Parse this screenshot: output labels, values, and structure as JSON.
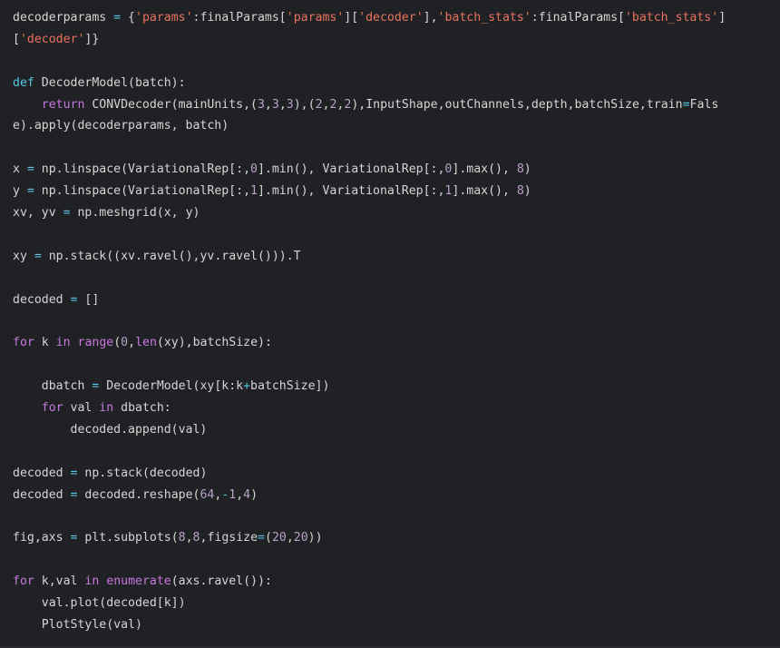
{
  "colors": {
    "background": "#202124",
    "text": "#d5d5d5",
    "keyword": "#c679dd",
    "def_keyword": "#58c7e0",
    "string": "#e8735e",
    "number": "#b9a0c8",
    "operator": "#58c7e0"
  },
  "code_lines": [
    [
      [
        "p",
        "decoderparams "
      ],
      [
        "o",
        "="
      ],
      [
        "p",
        " {"
      ],
      [
        "s",
        "'params'"
      ],
      [
        "p",
        ":finalParams["
      ],
      [
        "s",
        "'params'"
      ],
      [
        "p",
        "]["
      ],
      [
        "s",
        "'decoder'"
      ],
      [
        "p",
        "],"
      ],
      [
        "s",
        "'batch_stats'"
      ],
      [
        "p",
        ":finalParams["
      ],
      [
        "s",
        "'batch_stats'"
      ],
      [
        "p",
        "]"
      ]
    ],
    [
      [
        "p",
        "["
      ],
      [
        "s",
        "'decoder'"
      ],
      [
        "p",
        "]}"
      ]
    ],
    [],
    [
      [
        "d",
        "def"
      ],
      [
        "p",
        " DecoderModel(batch):"
      ]
    ],
    [
      [
        "p",
        "    "
      ],
      [
        "k",
        "return"
      ],
      [
        "p",
        " CONVDecoder(mainUnits,("
      ],
      [
        "n",
        "3"
      ],
      [
        "p",
        ","
      ],
      [
        "n",
        "3"
      ],
      [
        "p",
        ","
      ],
      [
        "n",
        "3"
      ],
      [
        "p",
        "),("
      ],
      [
        "n",
        "2"
      ],
      [
        "p",
        ","
      ],
      [
        "n",
        "2"
      ],
      [
        "p",
        ","
      ],
      [
        "n",
        "2"
      ],
      [
        "p",
        "),InputShape,outChannels,depth,batchSize,train"
      ],
      [
        "o",
        "="
      ],
      [
        "p",
        "Fals"
      ]
    ],
    [
      [
        "p",
        "e).apply(decoderparams, batch)"
      ]
    ],
    [],
    [
      [
        "p",
        "x "
      ],
      [
        "o",
        "="
      ],
      [
        "p",
        " np.linspace(VariationalRep[:,"
      ],
      [
        "n",
        "0"
      ],
      [
        "p",
        "].min(), VariationalRep[:,"
      ],
      [
        "n",
        "0"
      ],
      [
        "p",
        "].max(), "
      ],
      [
        "n",
        "8"
      ],
      [
        "p",
        ")"
      ]
    ],
    [
      [
        "p",
        "y "
      ],
      [
        "o",
        "="
      ],
      [
        "p",
        " np.linspace(VariationalRep[:,"
      ],
      [
        "n",
        "1"
      ],
      [
        "p",
        "].min(), VariationalRep[:,"
      ],
      [
        "n",
        "1"
      ],
      [
        "p",
        "].max(), "
      ],
      [
        "n",
        "8"
      ],
      [
        "p",
        ")"
      ]
    ],
    [
      [
        "p",
        "xv, yv "
      ],
      [
        "o",
        "="
      ],
      [
        "p",
        " np.meshgrid(x, y)"
      ]
    ],
    [],
    [
      [
        "p",
        "xy "
      ],
      [
        "o",
        "="
      ],
      [
        "p",
        " np.stack((xv.ravel(),yv.ravel())).T"
      ]
    ],
    [],
    [
      [
        "p",
        "decoded "
      ],
      [
        "o",
        "="
      ],
      [
        "p",
        " []"
      ]
    ],
    [],
    [
      [
        "k",
        "for"
      ],
      [
        "p",
        " k "
      ],
      [
        "k",
        "in"
      ],
      [
        "p",
        " "
      ],
      [
        "k",
        "range"
      ],
      [
        "p",
        "("
      ],
      [
        "n",
        "0"
      ],
      [
        "p",
        ","
      ],
      [
        "k",
        "len"
      ],
      [
        "p",
        "(xy),batchSize):"
      ]
    ],
    [],
    [
      [
        "p",
        "    dbatch "
      ],
      [
        "o",
        "="
      ],
      [
        "p",
        " DecoderModel(xy[k:k"
      ],
      [
        "o",
        "+"
      ],
      [
        "p",
        "batchSize])"
      ]
    ],
    [
      [
        "p",
        "    "
      ],
      [
        "k",
        "for"
      ],
      [
        "p",
        " val "
      ],
      [
        "k",
        "in"
      ],
      [
        "p",
        " dbatch:"
      ]
    ],
    [
      [
        "p",
        "        decoded.append(val)"
      ]
    ],
    [],
    [
      [
        "p",
        "decoded "
      ],
      [
        "o",
        "="
      ],
      [
        "p",
        " np.stack(decoded)"
      ]
    ],
    [
      [
        "p",
        "decoded "
      ],
      [
        "o",
        "="
      ],
      [
        "p",
        " decoded.reshape("
      ],
      [
        "n",
        "64"
      ],
      [
        "p",
        ","
      ],
      [
        "o",
        "-"
      ],
      [
        "n",
        "1"
      ],
      [
        "p",
        ","
      ],
      [
        "n",
        "4"
      ],
      [
        "p",
        ")"
      ]
    ],
    [],
    [
      [
        "p",
        "fig,axs "
      ],
      [
        "o",
        "="
      ],
      [
        "p",
        " plt.subplots("
      ],
      [
        "n",
        "8"
      ],
      [
        "p",
        ","
      ],
      [
        "n",
        "8"
      ],
      [
        "p",
        ",figsize"
      ],
      [
        "o",
        "="
      ],
      [
        "p",
        "("
      ],
      [
        "n",
        "20"
      ],
      [
        "p",
        ","
      ],
      [
        "n",
        "20"
      ],
      [
        "p",
        "))"
      ]
    ],
    [],
    [
      [
        "k",
        "for"
      ],
      [
        "p",
        " k,val "
      ],
      [
        "k",
        "in"
      ],
      [
        "p",
        " "
      ],
      [
        "k",
        "enumerate"
      ],
      [
        "p",
        "(axs.ravel()):"
      ]
    ],
    [
      [
        "p",
        "    val.plot(decoded[k])"
      ]
    ],
    [
      [
        "p",
        "    PlotStyle(val)"
      ]
    ]
  ]
}
